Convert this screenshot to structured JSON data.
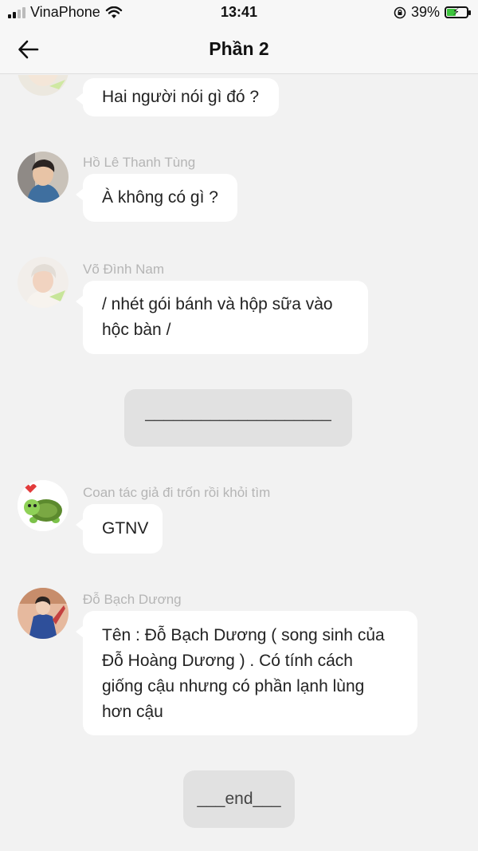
{
  "status_bar": {
    "carrier": "VinaPhone",
    "time": "13:41",
    "battery_percent": "39%"
  },
  "nav": {
    "title": "Phần 2"
  },
  "messages": [
    {
      "sender": "",
      "text": "Hai người nói gì đó ?"
    },
    {
      "sender": "Hồ Lê Thanh Tùng",
      "text": "À không có gì ?"
    },
    {
      "sender": "Võ Đình Nam",
      "text": "/ nhét gói bánh và hộp sữa vào hộc bàn /"
    },
    {
      "narration": "____________________"
    },
    {
      "sender": "Coan tác giả đi trốn rồi khỏi tìm",
      "text": "GTNV"
    },
    {
      "sender": "Đỗ Bạch Dương",
      "text": "Tên : Đỗ Bạch Dương ( song sinh của Đỗ Hoàng Dương ) . Có tính cách giống cậu nhưng có phần lạnh lùng hơn cậu"
    },
    {
      "narration": "___end___"
    }
  ],
  "colors": {
    "background": "#f2f2f2",
    "bubble": "#ffffff",
    "narration_bubble": "#e1e1e1",
    "sender_name": "#b5b5b5",
    "battery_fill": "#3cc43c"
  },
  "icons": {
    "back": "arrow-left-icon",
    "wifi": "wifi-icon",
    "lock": "rotation-lock-icon",
    "battery": "battery-charging-icon"
  }
}
